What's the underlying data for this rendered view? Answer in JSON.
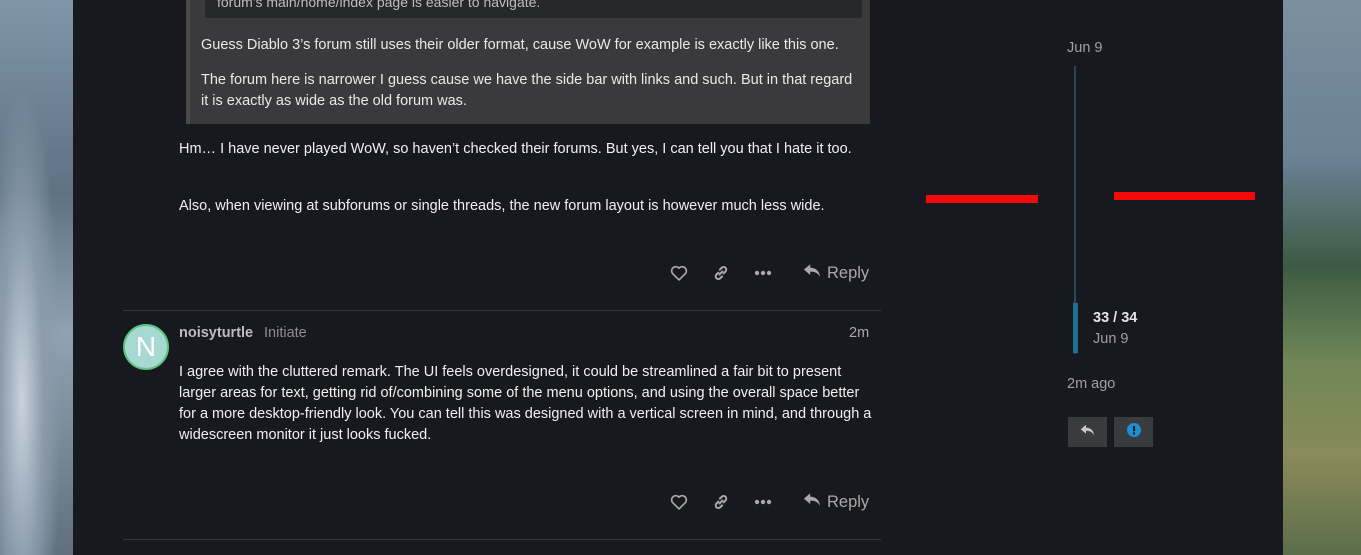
{
  "quote": {
    "cut_line": "forum's main/home/index page is easier to navigate.",
    "paragraphs": [
      "Guess Diablo 3’s forum still uses their older format, cause WoW for example is exactly like this one.",
      "The forum here is narrower I guess cause we have the side bar with links and such. But in that regard it is exactly as wide as the old forum was."
    ]
  },
  "post1": {
    "paragraphs": [
      "Hm… I have never played WoW, so haven’t checked their forums. But yes, I can tell you that I hate it too.",
      "Also, when viewing at subforums or single threads, the new forum layout is however much less wide."
    ],
    "reply_label": "Reply"
  },
  "post2": {
    "avatar_letter": "N",
    "username": "noisyturtle",
    "user_title": "Initiate",
    "time": "2m",
    "text": "I agree with the cluttered remark. The UI feels overdesigned, it could be streamlined a fair bit to present larger areas for text, getting rid of/combining some of the menu options, and using the overall space better for a more desktop-friendly look. You can tell this was designed with a vertical screen in mind, and through a widescreen monitor it just looks fucked.",
    "reply_label": "Reply"
  },
  "timeline": {
    "top_date": "Jun 9",
    "count": "33 / 34",
    "count_date": "Jun 9",
    "bottom_label": "2m ago"
  },
  "icons": {
    "like": "heart-icon",
    "link": "link-icon",
    "more": "ellipsis-icon",
    "reply": "reply-icon",
    "notification": "exclamation-circle-icon"
  },
  "colors": {
    "background": "#18191e",
    "accent": "#1f6f95",
    "annotation_red": "#f40a0a",
    "avatar_bg": "#a7d8d2",
    "avatar_ring": "#58c47e"
  }
}
